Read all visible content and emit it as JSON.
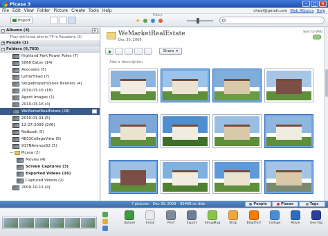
{
  "window": {
    "title": "Picasa 3"
  },
  "menu": [
    "File",
    "Edit",
    "View",
    "Folder",
    "Picture",
    "Create",
    "Tools",
    "Help"
  ],
  "account": {
    "email": "cheyl@gmail.com",
    "links": [
      "Web Albums",
      "Help"
    ]
  },
  "toolbar": {
    "import_label": "Import",
    "filters_label": "Filters",
    "search_placeholder": ""
  },
  "sidebar": {
    "albums_label": "Albums (4)",
    "albums_hint": "They still know who to TP in Pasadena (3)",
    "people_label": "People (1)",
    "folders_label": "Folders (6,783)",
    "folders": [
      {
        "label": "Highland Park Power Poles (7)"
      },
      {
        "label": "5066 Eaton (14)"
      },
      {
        "label": "Avocados (5)"
      },
      {
        "label": "LetterHead (7)"
      },
      {
        "label": "SinglePropertySites Banners (4)"
      },
      {
        "label": "2010-03-16 (18)"
      },
      {
        "label": "Agent Images (1)"
      },
      {
        "label": "2010-03-16 (4)"
      },
      {
        "label": "WeMarketRealEstate (28)"
      },
      {
        "label": "2010-01-01 (5)"
      },
      {
        "label": "12-27-2009 (246)"
      },
      {
        "label": "Netbook (5)"
      },
      {
        "label": "4833CollegeView (8)"
      },
      {
        "label": "917NAvenue52 (5)"
      }
    ],
    "picasa_label": "Picasa (2)",
    "picasa_children": [
      {
        "label": "Movies (4)"
      },
      {
        "label": "Screen Captures (3)"
      },
      {
        "label": "Exported Videos (16)"
      },
      {
        "label": "Captured Videos (2)"
      }
    ],
    "last_folder": "2009-10-11 (4)"
  },
  "album": {
    "title": "WeMarketRealEstate",
    "date": "Dec 30, 2009",
    "sync_label_1": "Sync to Web",
    "sync_label_2": "Off",
    "share_label": "Share",
    "description_placeholder": "Add a description"
  },
  "status": {
    "count": "7 pictures",
    "date": "Dec 30, 2009",
    "size": "824KB on disk",
    "buttons": [
      "People",
      "Places",
      "Tags"
    ]
  },
  "tray": {
    "actions": [
      "Upload",
      "Email",
      "Print",
      "Export",
      "SmugMug",
      "Shop",
      "BlogThis!",
      "Collage",
      "Movie",
      "Geo-Tag"
    ],
    "action_colors": [
      "#3d9b3d",
      "#e9e9e9",
      "#7f8a99",
      "#6d7d94",
      "#8bc34a",
      "#f0a63b",
      "#f57c00",
      "#4a8fd6",
      "#2d6cc0",
      "#2b3e9c"
    ]
  }
}
